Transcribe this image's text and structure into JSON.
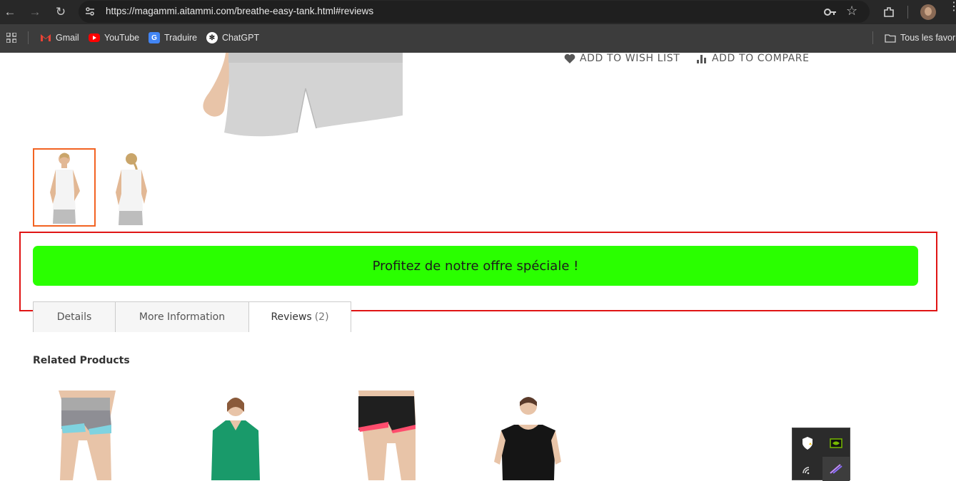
{
  "browser": {
    "url": "https://magammi.aitammi.com/breathe-easy-tank.html#reviews",
    "bookmarks": [
      {
        "label": "Gmail",
        "icon": "gmail-icon"
      },
      {
        "label": "YouTube",
        "icon": "youtube-icon"
      },
      {
        "label": "Traduire",
        "icon": "translate-icon"
      },
      {
        "label": "ChatGPT",
        "icon": "chatgpt-icon"
      }
    ],
    "favorites_folder": "Tous les favoris"
  },
  "product": {
    "wishlist_label": "ADD TO WISH LIST",
    "compare_label": "ADD TO COMPARE",
    "offer_label": "Profitez de notre offre spéciale !",
    "tabs": [
      {
        "label": "Details"
      },
      {
        "label": "More Information"
      },
      {
        "label": "Reviews",
        "count": "(2)"
      }
    ]
  },
  "related": {
    "title": "Related Products"
  },
  "colors": {
    "offer_bg": "#2aff00",
    "highlight_border": "#e01414",
    "thumb_active": "#f26322"
  }
}
